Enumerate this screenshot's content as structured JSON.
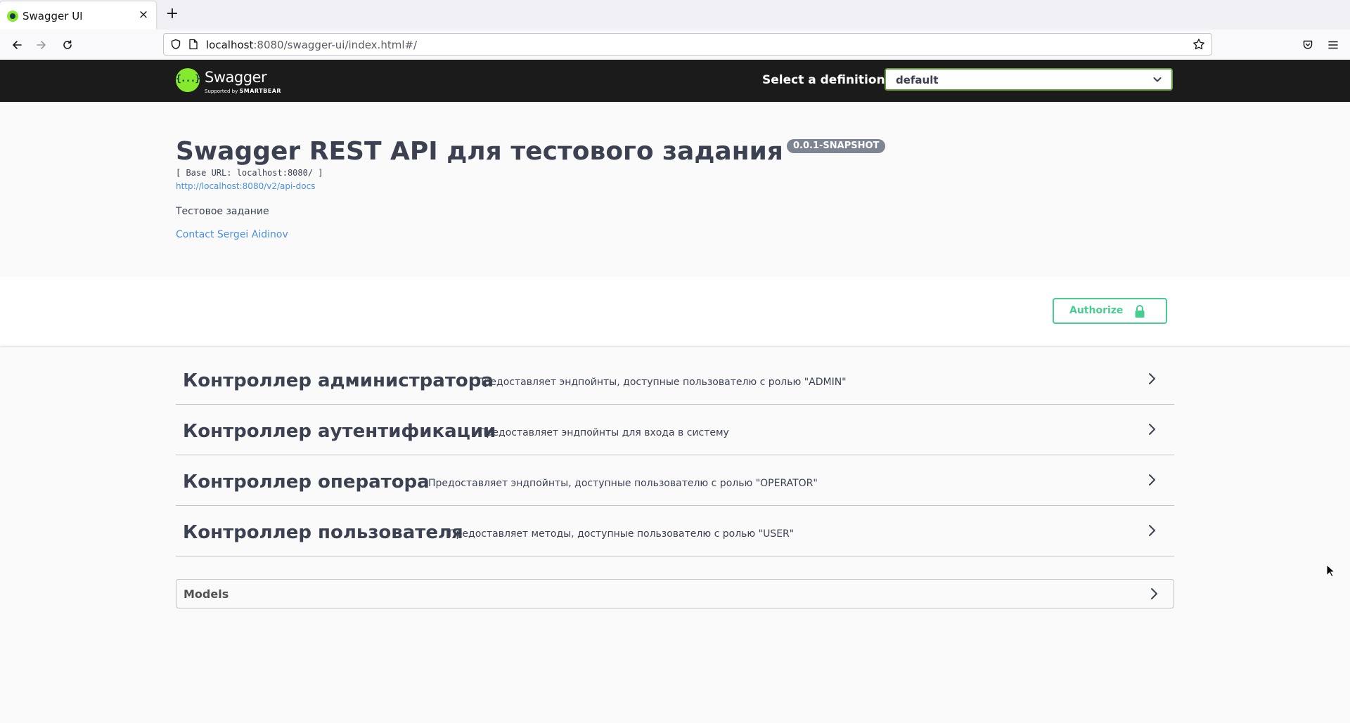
{
  "browser": {
    "tab_title": "Swagger UI",
    "tab_close": "×",
    "new_tab": "+",
    "url_host": "localhost",
    "url_rest": ":8080/swagger-ui/index.html#/"
  },
  "topbar": {
    "logo_text": "Swagger",
    "logo_mark": "{...}",
    "logo_sub_prefix": "Supported by",
    "logo_sub_brand": "SMARTBEAR",
    "definition_label": "Select a definition",
    "definition_value": "default"
  },
  "info": {
    "title": "Swagger REST API для тестового задания",
    "version": "0.0.1-SNAPSHOT",
    "base_url": "[ Base URL: localhost:8080/ ]",
    "api_docs_link": "http://localhost:8080/v2/api-docs",
    "description": "Тестовое задание",
    "contact": "Contact Sergei Aidinov"
  },
  "auth": {
    "label": "Authorize"
  },
  "tags": [
    {
      "name": "Контроллер администратора",
      "description": "Предоставляет эндпойнты, доступные пользователю с ролью \"ADMIN\""
    },
    {
      "name": "Контроллер аутентификации",
      "description": "Предоставляет эндпойнты для входа в систему"
    },
    {
      "name": "Контроллер оператора",
      "description": "Предоставляет эндпойнты, доступные пользователю с ролью \"OPERATOR\""
    },
    {
      "name": "Контроллер пользователя",
      "description": "Предоставляет методы, доступные пользователю с ролью \"USER\""
    }
  ],
  "models": {
    "label": "Models"
  },
  "colors": {
    "accent_green": "#49cc90",
    "topbar_bg": "#1b1b1b",
    "link_blue": "#4990e2",
    "select_border": "#62a03f"
  },
  "icons": [
    "back-icon",
    "forward-icon",
    "reload-icon",
    "shield-icon",
    "page-icon",
    "star-icon",
    "pocket-icon",
    "menu-icon",
    "chevron-down-icon",
    "lock-icon",
    "chevron-right-icon"
  ]
}
